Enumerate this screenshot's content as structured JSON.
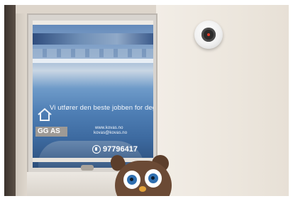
{
  "scene": "photo",
  "window_sign": {
    "slogan": "Vi utfører den beste jobben for deg",
    "website": "www.kovas.no",
    "email": "kovas@kovas.no",
    "phone": "97796417",
    "company_fragment": "GG AS"
  },
  "colors": {
    "wall": "#ece6dd",
    "glass": "#4f7fb5",
    "detector_led": "#e23b2b",
    "owl_fur": "#6b4a35",
    "owl_eye": "#2f6fb0"
  }
}
